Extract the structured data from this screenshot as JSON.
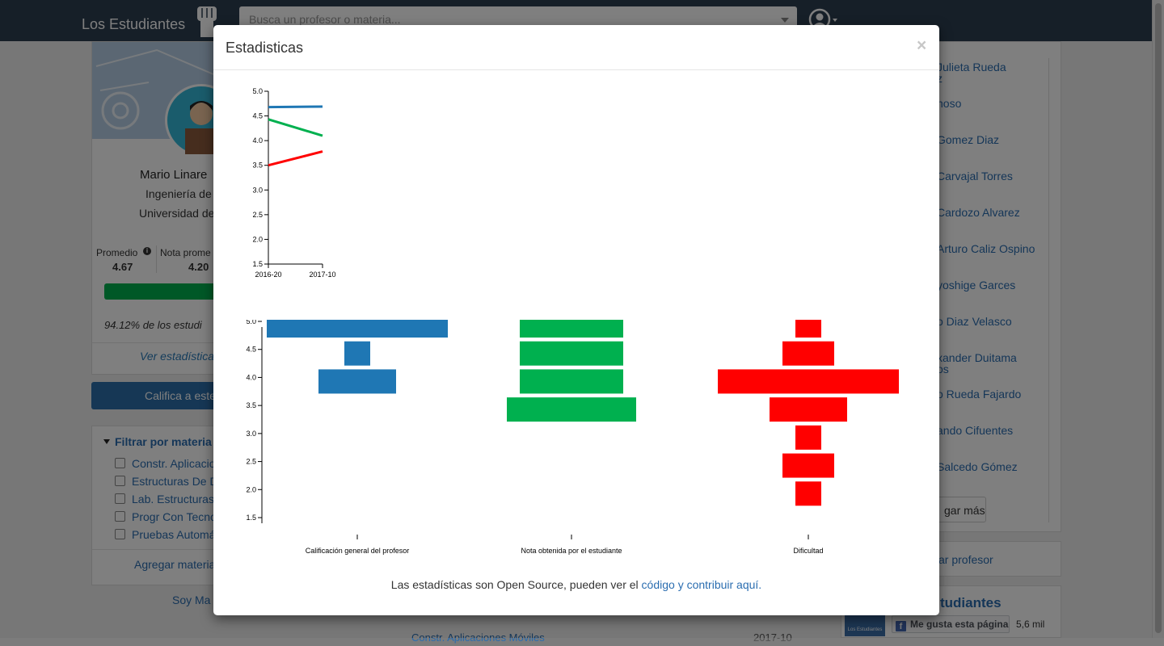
{
  "nav": {
    "brand": "Los Estudiantes",
    "search_placeholder": "Busca un profesor o materia..."
  },
  "profile": {
    "name": "Mario Linare",
    "department": "Ingeniería de",
    "university": "Universidad de",
    "stats": [
      {
        "label": "Promedio",
        "value": "4.67"
      },
      {
        "label": "Nota prome",
        "value": "4.20"
      }
    ],
    "percent_text": "94.12% de los estudi",
    "see_stats": "Ver estadística",
    "rate_button": "Califica a este"
  },
  "filter": {
    "title": "Filtrar por materia",
    "items": [
      "Constr. Aplicacio",
      "Estructuras De D",
      "Lab. Estructuras",
      "Progr Con Tecno",
      "Pruebas Automá"
    ],
    "add": "Agregar materia"
  },
  "soy_link": "Soy Ma",
  "bottom_row": {
    "course": "Constr. Aplicaciones Móviles",
    "period": "2017-10"
  },
  "right": {
    "professors": [
      {
        "text": "Julieta Rueda",
        "text2": "z"
      },
      {
        "text": "noso"
      },
      {
        "text": "Gomez Diaz"
      },
      {
        "text": "Carvajal Torres"
      },
      {
        "text": "Cardozo Alvarez"
      },
      {
        "text": "Arturo Caliz Ospino"
      },
      {
        "text": "yoshige Garces"
      },
      {
        "text": "o Diaz Velasco"
      },
      {
        "text": "xander Duitama",
        "text2": "os"
      },
      {
        "text": "o Rueda Fajardo"
      },
      {
        "text": "ando Cifuentes"
      },
      {
        "text": "Salcedo Gómez"
      }
    ],
    "load_more": "gar más",
    "add_professor": "ar profesor",
    "fb_title": "tudiantes",
    "fb_thumb": "Los Estudiantes",
    "fb_like": "Me gusta esta página",
    "fb_count": "5,6 mil"
  },
  "modal": {
    "title": "Estadisticas",
    "close": "×",
    "footer_text": "Las estadísticas son Open Source, pueden ver el ",
    "footer_link": "código y contribuir aquí."
  },
  "chart_data": [
    {
      "type": "line",
      "x": [
        "2016-20",
        "2017-10"
      ],
      "ylim": [
        1.5,
        5.0
      ],
      "yticks": [
        "5.0",
        "4.5",
        "4.0",
        "3.5",
        "3.0",
        "2.5",
        "2.0",
        "1.5"
      ],
      "series": [
        {
          "color": "#1f77b4",
          "values": [
            4.68,
            4.69
          ]
        },
        {
          "color": "#00b04f",
          "values": [
            4.43,
            4.1
          ]
        },
        {
          "color": "#ff0000",
          "values": [
            3.5,
            3.78
          ]
        }
      ]
    },
    {
      "type": "bar",
      "orientation": "horizontal-histogram",
      "ylim": [
        1.5,
        5.0
      ],
      "yticks": [
        "5.0",
        "4.5",
        "4.0",
        "3.5",
        "3.0",
        "2.5",
        "2.0",
        "1.5"
      ],
      "categories": [
        "Calificación general del profesor",
        "Nota obtenida por el estudiante",
        "Dificultad"
      ],
      "series": [
        {
          "color": "#1f77b4",
          "bins": [
            {
              "value": 5.0,
              "count": 7
            },
            {
              "value": 4.5,
              "count": 1
            },
            {
              "value": 4.0,
              "count": 3
            }
          ]
        },
        {
          "color": "#00b04f",
          "bins": [
            {
              "value": 5.0,
              "count": 4
            },
            {
              "value": 4.5,
              "count": 4
            },
            {
              "value": 4.0,
              "count": 4
            },
            {
              "value": 3.5,
              "count": 5
            }
          ]
        },
        {
          "color": "#ff0000",
          "bins": [
            {
              "value": 5.0,
              "count": 1
            },
            {
              "value": 4.5,
              "count": 2
            },
            {
              "value": 4.0,
              "count": 7
            },
            {
              "value": 3.5,
              "count": 3
            },
            {
              "value": 3.0,
              "count": 1
            },
            {
              "value": 2.5,
              "count": 2
            },
            {
              "value": 2.0,
              "count": 1
            }
          ]
        }
      ]
    }
  ]
}
